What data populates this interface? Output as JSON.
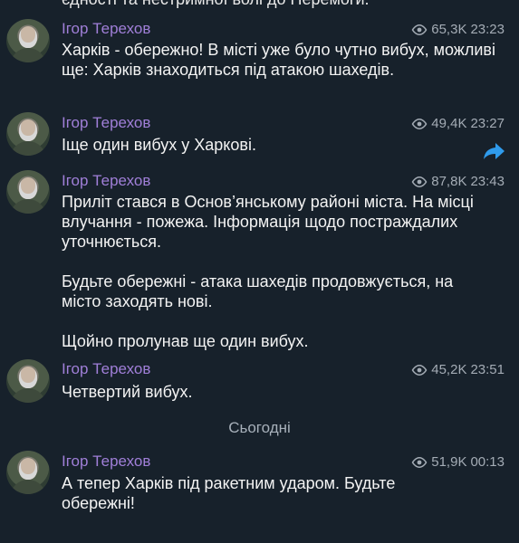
{
  "top_cut_text": "єдності та нестримної волі до Перемоги.",
  "messages": [
    {
      "author": "Ігор Терехов",
      "views": "65,3K",
      "time": "23:23",
      "paragraphs": [
        "Харків - обережно! В місті уже було чутно вибух, можливі ще: Харків знаходиться під атакою шахедів."
      ]
    },
    {
      "author": "Ігор Терехов",
      "views": "49,4K",
      "time": "23:27",
      "paragraphs": [
        "Іще один вибух у Харкові."
      ]
    },
    {
      "author": "Ігор Терехов",
      "views": "87,8K",
      "time": "23:43",
      "paragraphs": [
        "Приліт стався в Основ’янському районі міста. На місці влучання - пожежа. Інформація щодо постраждалих уточнюється.",
        "Будьте обережні - атака шахедів продовжується, на місто заходять нові.",
        "Щойно пролунав ще один вибух."
      ]
    },
    {
      "author": "Ігор Терехов",
      "views": "45,2K",
      "time": "23:51",
      "paragraphs": [
        "Четвертий вибух."
      ]
    },
    {
      "author": "Ігор Терехов",
      "views": "51,9K",
      "time": "00:13",
      "paragraphs": [
        "А тепер Харків під ракетним ударом. Будьте обережні!"
      ]
    }
  ],
  "date_separator": "Сьогодні",
  "icons": {
    "views": "eye-icon",
    "forward": "forward-icon",
    "avatar": "avatar"
  },
  "colors": {
    "background": "#17212b",
    "author": "#a07fd8",
    "meta": "#a4acb5",
    "forward": "#2f9bec"
  }
}
